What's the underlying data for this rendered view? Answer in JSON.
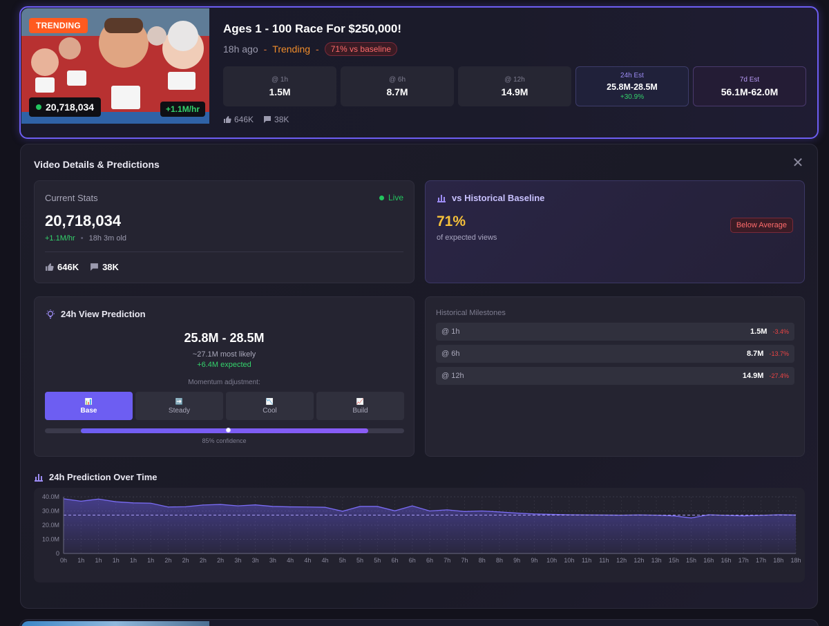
{
  "video": {
    "badge": "TRENDING",
    "views_pill": "20,718,034",
    "rate_pill": "+1.1M/hr",
    "title": "Ages 1 - 100 Race For $250,000!",
    "ago": "18h ago",
    "sep": "-",
    "trend": "Trending",
    "baseline_pill": "71% vs baseline",
    "stats": [
      {
        "label": "@ 1h",
        "value": "1.5M"
      },
      {
        "label": "@ 6h",
        "value": "8.7M"
      },
      {
        "label": "@ 12h",
        "value": "14.9M"
      }
    ],
    "est24": {
      "label": "24h Est",
      "value": "25.8M-28.5M",
      "sub": "+30.9%"
    },
    "est7d": {
      "label": "7d Est",
      "value": "56.1M-62.0M"
    },
    "likes": "646K",
    "comments": "38K"
  },
  "details": {
    "title": "Video Details & Predictions",
    "close": "✕",
    "current": {
      "header": "Current Stats",
      "live": "Live",
      "views": "20,718,034",
      "rate": "+1.1M/hr",
      "bullet": "•",
      "age": "18h 3m old",
      "likes": "646K",
      "comments": "38K"
    },
    "baseline": {
      "header": "vs Historical Baseline",
      "pct": "71%",
      "desc": "of expected views",
      "badge": "Below Average"
    },
    "prediction": {
      "header": "24h View Prediction",
      "range": "25.8M - 28.5M",
      "likely": "~27.1M most likely",
      "expected": "+6.4M expected",
      "momentum": "Momentum adjustment:",
      "tabs": [
        {
          "icon": "📊",
          "label": "Base",
          "active": true
        },
        {
          "icon": "➡️",
          "label": "Steady",
          "active": false
        },
        {
          "icon": "📉",
          "label": "Cool",
          "active": false
        },
        {
          "icon": "📈",
          "label": "Build",
          "active": false
        }
      ],
      "confidence_low": 0.1,
      "confidence_high": 0.9,
      "confidence_mark": 0.51,
      "confidence": "85% confidence"
    },
    "milestones": {
      "header": "Historical Milestones",
      "rows": [
        {
          "label": "@ 1h",
          "value": "1.5M",
          "delta": "-3.4%"
        },
        {
          "label": "@ 6h",
          "value": "8.7M",
          "delta": "-13.7%"
        },
        {
          "label": "@ 12h",
          "value": "14.9M",
          "delta": "-27.4%"
        }
      ]
    },
    "chart_title": "24h Prediction Over Time"
  },
  "colors": {
    "accent": "#6d5ef2",
    "positive": "#22c55e",
    "negative": "#ef4444",
    "warning": "#f6c13a"
  },
  "chart_data": {
    "type": "area",
    "title": "24h Prediction Over Time",
    "xlabel": "",
    "ylabel": "",
    "ylim": [
      0,
      40
    ],
    "yticks": [
      "0",
      "10.0M",
      "20.0M",
      "30.0M",
      "40.0M"
    ],
    "x_labels": [
      "0h",
      "1h",
      "1h",
      "1h",
      "1h",
      "1h",
      "2h",
      "2h",
      "2h",
      "2h",
      "3h",
      "3h",
      "3h",
      "4h",
      "4h",
      "4h",
      "5h",
      "5h",
      "5h",
      "6h",
      "6h",
      "6h",
      "7h",
      "7h",
      "8h",
      "8h",
      "9h",
      "9h",
      "10h",
      "10h",
      "11h",
      "11h",
      "12h",
      "12h",
      "13h",
      "15h",
      "15h",
      "16h",
      "16h",
      "17h",
      "17h",
      "18h",
      "18h"
    ],
    "series": [
      {
        "values": [
          38.6,
          36.9,
          38.4,
          36.5,
          35.7,
          35.5,
          32.8,
          33.0,
          34.2,
          34.6,
          33.6,
          34.3,
          33.2,
          32.9,
          32.8,
          32.6,
          29.8,
          33.2,
          33.2,
          30.1,
          33.6,
          30.0,
          30.8,
          29.6,
          30.0,
          29.3,
          28.5,
          27.9,
          27.6,
          27.3,
          27.2,
          27.1,
          27.0,
          27.2,
          27.0,
          26.5,
          25.1,
          27.3,
          26.9,
          26.5,
          26.9,
          27.3,
          27.1
        ]
      }
    ],
    "reference_line": 27.1,
    "grid": true
  }
}
